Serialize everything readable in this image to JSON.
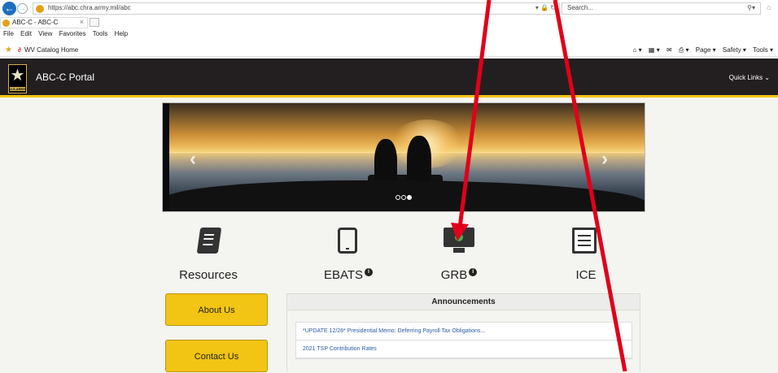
{
  "browser": {
    "url": "https://abc.chra.army.mil/abc",
    "search_placeholder": "Search...",
    "tab_title": "ABC-C - ABC-C",
    "menu": [
      "File",
      "Edit",
      "View",
      "Favorites",
      "Tools",
      "Help"
    ],
    "favorite": "WV Catalog Home",
    "commands": [
      "Page ▾",
      "Safety ▾",
      "Tools ▾"
    ]
  },
  "header": {
    "army_text": "U.S.ARMY",
    "title": "ABC-C Portal",
    "quick_links": "Quick Links ⌄"
  },
  "carousel": {
    "prev": "‹",
    "next": "›",
    "slides": 3,
    "active": 3
  },
  "tiles": [
    {
      "label": "Resources",
      "icon": "book-icon",
      "info": false
    },
    {
      "label": "EBATS",
      "icon": "tablet-icon",
      "info": true
    },
    {
      "label": "GRB",
      "icon": "monitor-check-icon",
      "info": true
    },
    {
      "label": "ICE",
      "icon": "newspaper-icon",
      "info": false
    }
  ],
  "info_glyph": "i",
  "buttons": {
    "about": "About Us",
    "contact": "Contact Us"
  },
  "announcements": {
    "title": "Announcements",
    "items": [
      "*UPDATE 12/28* Presidential Memo: Deferring Payroll Tax Obligations...",
      "2021 TSP Contribution Rates"
    ]
  },
  "colors": {
    "accent": "#f2c414",
    "header_bg": "#231f20",
    "annotation_arrow": "#e0001a"
  }
}
